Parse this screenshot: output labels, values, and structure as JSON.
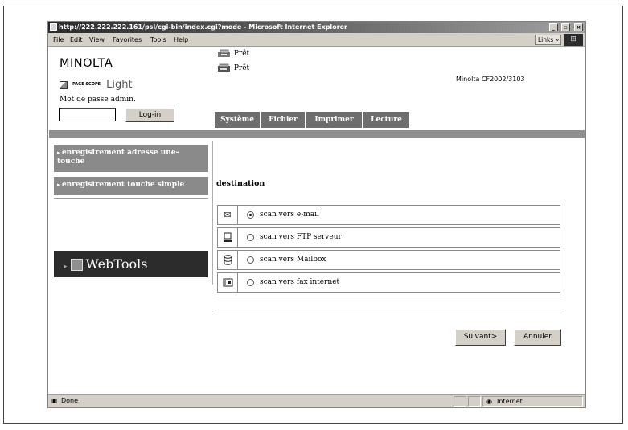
{
  "window": {
    "title": "http://222.222.222.161/psl/cgi-bin/index.cgi?mode - Microsoft Internet Explorer",
    "controls": [
      "_",
      "8",
      "x"
    ]
  },
  "menubar": {
    "items": [
      "File",
      "Edit",
      "View",
      "Favorites",
      "Tools",
      "Help"
    ],
    "links_label": "Links »"
  },
  "header": {
    "brand": "MINOLTA",
    "product_small": "PAGE SCOPE",
    "product_light": "Light",
    "printer_status": [
      "Prêt",
      "Prêt"
    ],
    "model": "Minolta CF2002/3103"
  },
  "login": {
    "label": "Mot de passe admin.",
    "password_value": "",
    "button": "Log-in"
  },
  "tabs": [
    "Système",
    "Fichier",
    "Imprimer",
    "Lecture"
  ],
  "sidebar": {
    "items": [
      {
        "label": "enregistrement adresse une-touche",
        "active": true
      },
      {
        "label": "enregistrement touche simple",
        "active": false
      }
    ],
    "webtools": "WebTools"
  },
  "destination": {
    "title": "destination",
    "options": [
      {
        "icon": "envelope-icon",
        "glyph": "✉",
        "label": "scan vers e-mail",
        "checked": true
      },
      {
        "icon": "computer-icon",
        "glyph": "🖳",
        "label": "scan vers FTP serveur",
        "checked": false
      },
      {
        "icon": "mailbox-icon",
        "glyph": "☷",
        "label": "scan vers Mailbox",
        "checked": false
      },
      {
        "icon": "fax-icon",
        "glyph": "☎",
        "label": "scan vers fax internet",
        "checked": false
      }
    ]
  },
  "actions": {
    "next": "Suivant>",
    "cancel": "Annuler"
  },
  "statusbar": {
    "left": "Done",
    "zone": "Internet"
  }
}
